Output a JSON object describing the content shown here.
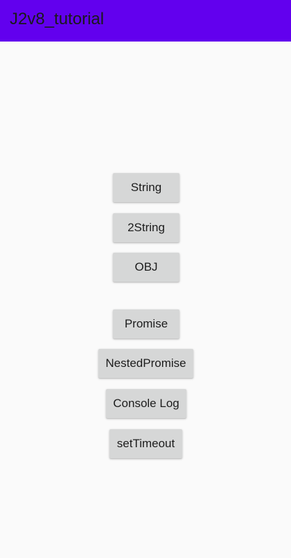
{
  "app_bar": {
    "title": "J2v8_tutorial",
    "color": "#6200ee"
  },
  "buttons": {
    "string": "String",
    "two_string": "2String",
    "obj": "OBJ",
    "promise": "Promise",
    "nested_promise": "NestedPromise",
    "console_log": "Console Log",
    "set_timeout": "setTimeout"
  },
  "colors": {
    "background": "#fafafa",
    "button": "#d6d7d7"
  }
}
